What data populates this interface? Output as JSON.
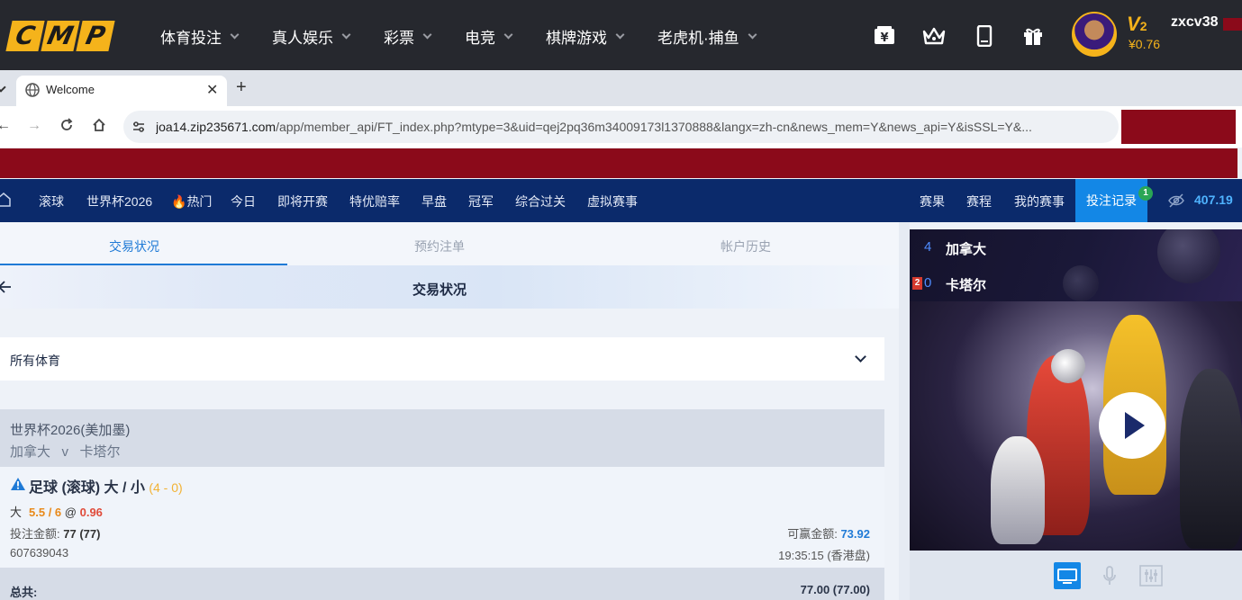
{
  "site": {
    "logo_letters": [
      "C",
      "M",
      "P"
    ],
    "nav": [
      {
        "label": "体育投注"
      },
      {
        "label": "真人娱乐"
      },
      {
        "label": "彩票"
      },
      {
        "label": "电竞"
      },
      {
        "label": "棋牌游戏"
      },
      {
        "label": "老虎机·捕鱼"
      }
    ],
    "icons": [
      "yen-wallet-icon",
      "crown-icon",
      "mobile-icon",
      "gift-icon"
    ],
    "user": {
      "vip_level": "V",
      "vip_num": "2",
      "balance": "¥0.76",
      "username": "zxcv38"
    }
  },
  "browser": {
    "tab_title": "Welcome",
    "url_host": "joa14.zip235671.com",
    "url_path": "/app/member_api/FT_index.php?mtype=3&uid=qej2pq36m34009173l1370888&langx=zh-cn&news_mem=Y&news_api=Y&isSSL=Y&..."
  },
  "sport_nav": {
    "items": [
      "滚球",
      "世界杯2026",
      "热门",
      "今日",
      "即将开赛",
      "特优赔率",
      "早盘",
      "冠军",
      "综合过关",
      "虚拟赛事"
    ],
    "right_items": [
      "赛果",
      "赛程",
      "我的赛事"
    ],
    "bet_record": "投注记录",
    "bet_record_count": "1",
    "balance": "407.19"
  },
  "main": {
    "tabs": [
      "交易状况",
      "预约注单",
      "帐户历史"
    ],
    "active_tab": 0,
    "page_title": "交易状况",
    "sport_filter": "所有体育",
    "event": {
      "league": "世界杯2026(美加墨)",
      "home": "加拿大",
      "vs": "v",
      "away": "卡塔尔"
    },
    "bet": {
      "type": "足球 (滚球) 大 / 小",
      "score": "(4 - 0)",
      "selection": "大",
      "handicap": "5.5 / 6",
      "at": "@",
      "odds": "0.96",
      "stake_label": "投注金额:",
      "stake_value": "77 (77)",
      "win_label": "可赢金额:",
      "win_value": "73.92",
      "ticket_id": "607639043",
      "time": "19:35:15 (香港盘)"
    },
    "total": {
      "label": "总共:",
      "value": "77.00 (77.00)"
    }
  },
  "live": {
    "home": {
      "score": "4",
      "name": "加拿大"
    },
    "away": {
      "score": "0",
      "name": "卡塔尔",
      "red_cards": "2"
    }
  },
  "colors": {
    "header_bg": "#26282e",
    "logo_yellow": "#f5b31b",
    "sport_nav_bg": "#0b2a6b",
    "accent_blue": "#1387e6",
    "redaction": "#8b0a1a"
  }
}
